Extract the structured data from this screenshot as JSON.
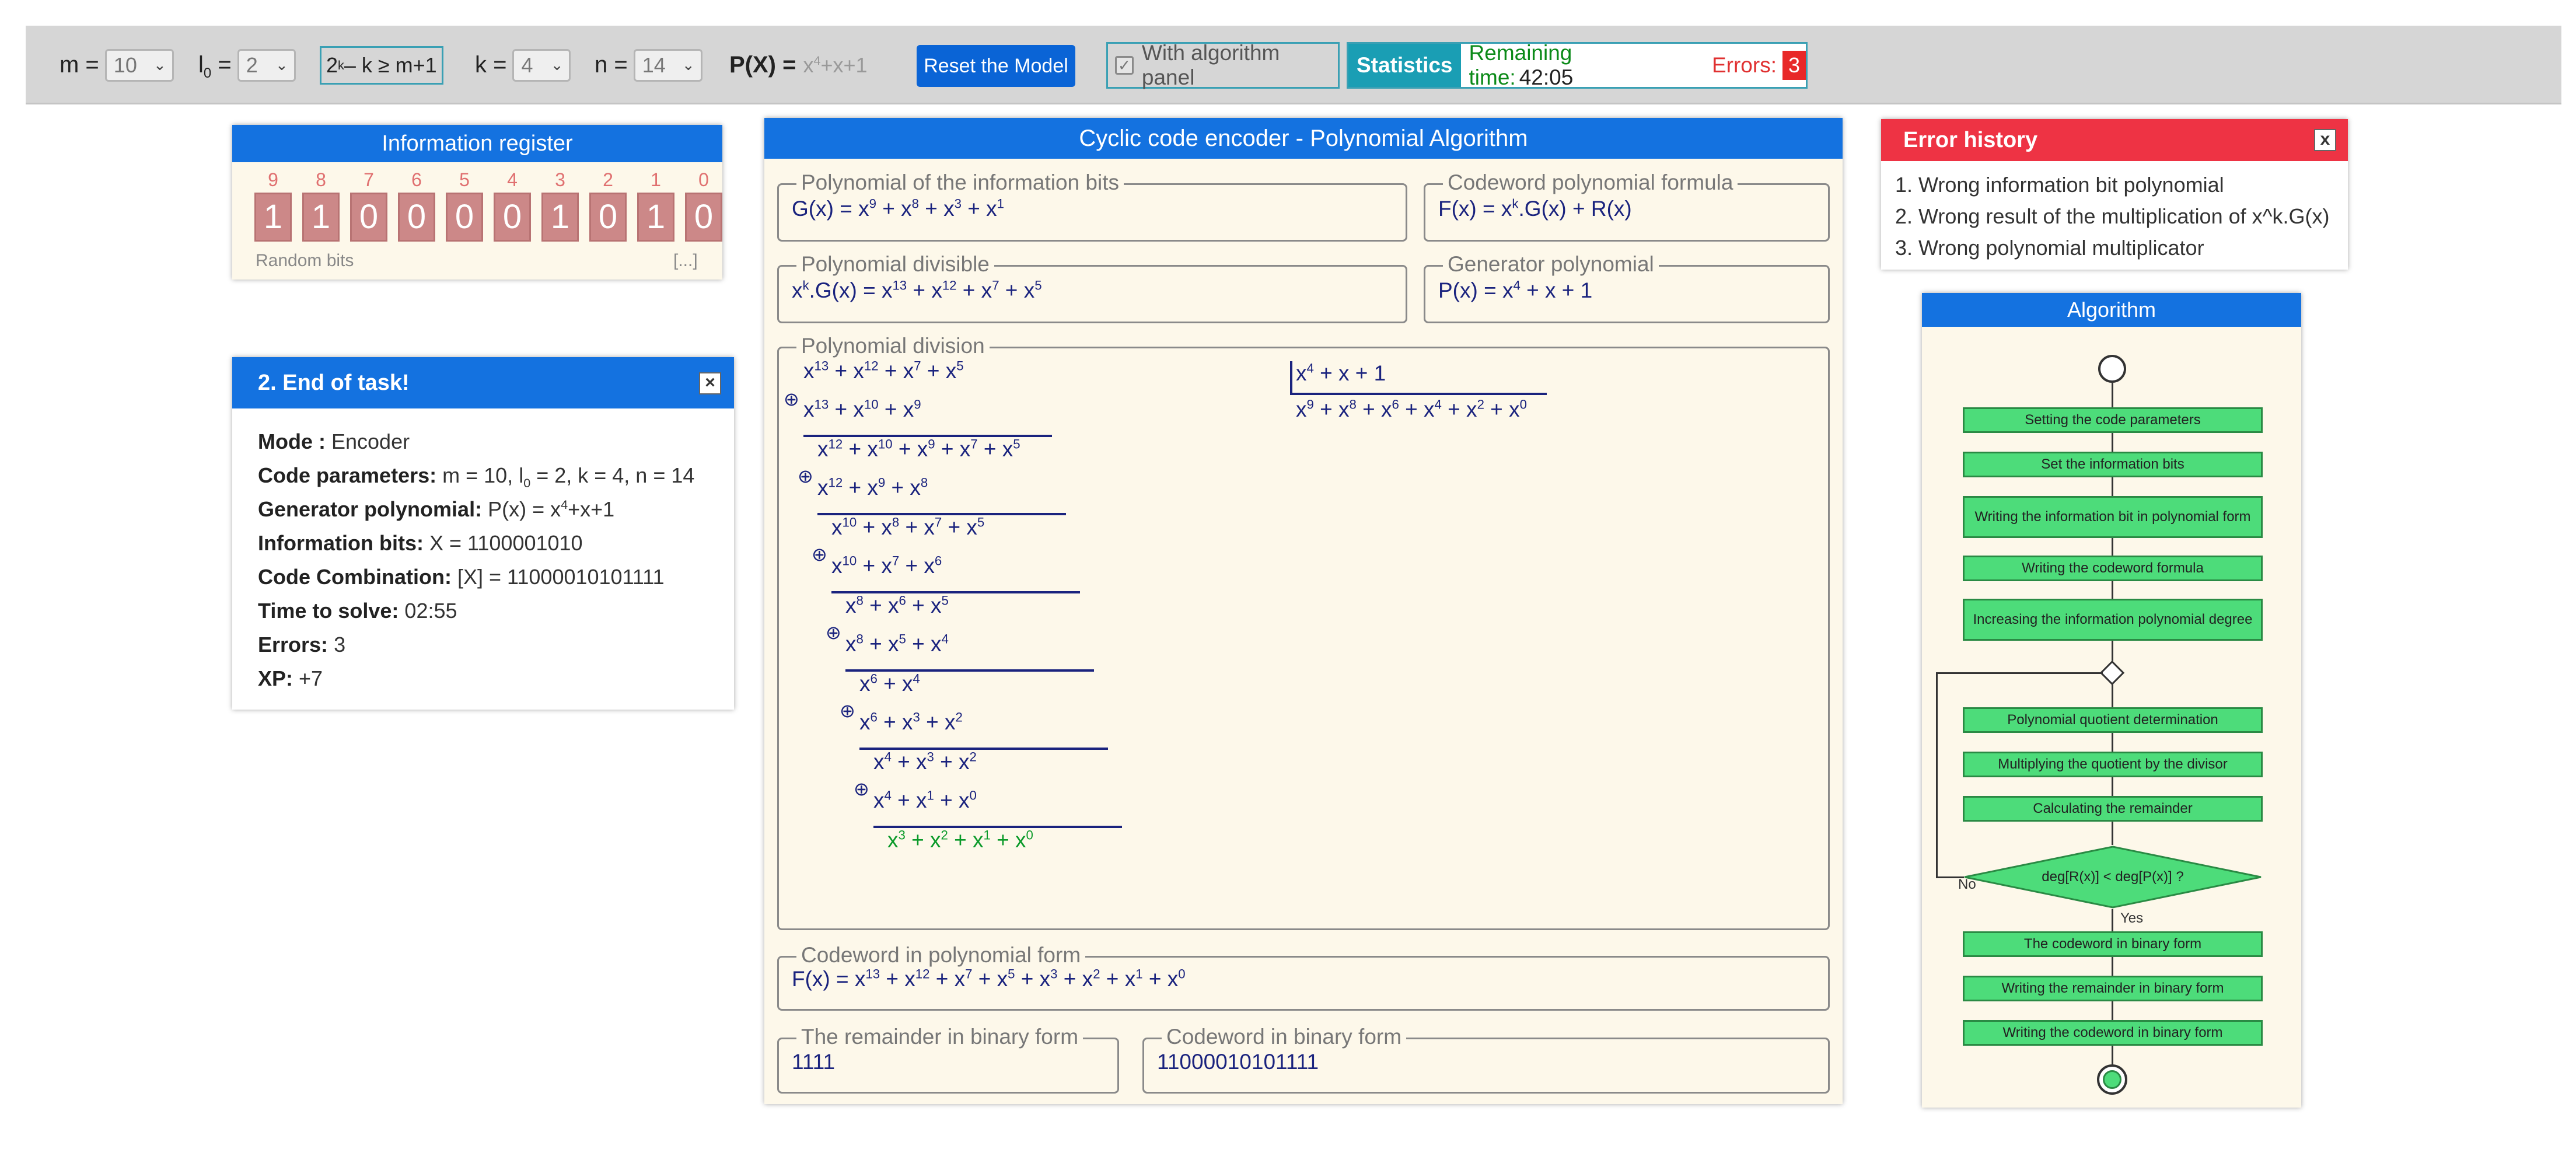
{
  "toolbar": {
    "m_label": "m =",
    "m_value": "10",
    "l0_label": "l",
    "l0_sub": "0",
    "l0_eq": " =",
    "l0_value": "2",
    "cond_base": "2",
    "cond_sup": "k",
    "cond_rest": "– k ≥ m+1",
    "k_label": "k =",
    "k_value": "4",
    "n_label": "n =",
    "n_value": "14",
    "px_label": "P(X) =",
    "px_x": "x",
    "px_sup": "4",
    "px_rest": "+x+1",
    "reset_label": "Reset the Model",
    "algo_panel_label": "With algorithm panel",
    "stats_label": "Statistics",
    "remaining_label": "Remaining time:",
    "remaining_value": "42:05",
    "errors_label": "Errors:",
    "errors_value": "3"
  },
  "info_register": {
    "title": "Information register",
    "indices": [
      "9",
      "8",
      "7",
      "6",
      "5",
      "4",
      "3",
      "2",
      "1",
      "0"
    ],
    "bits": [
      "1",
      "1",
      "0",
      "0",
      "0",
      "0",
      "1",
      "0",
      "1",
      "0"
    ],
    "random_label": "Random bits",
    "more_label": "[...]"
  },
  "end_task": {
    "title": "2. End of task!",
    "close": "×",
    "mode_label": "Mode :",
    "mode_value": "Encoder",
    "params_label": "Code parameters:",
    "params_value_a": "m = 10, l",
    "params_value_sub": "0",
    "params_value_b": " = 2, k = 4, n = 14",
    "gen_label": "Generator polynomial:",
    "gen_value_a": "P(x) = x",
    "gen_value_sup": "4",
    "gen_value_b": "+x+1",
    "bits_label": "Information bits:",
    "bits_value": "X = 1100001010",
    "combo_label": "Code Combination:",
    "combo_value": "[X] = 11000010101111",
    "time_label": "Time to solve:",
    "time_value": "02:55",
    "errors_label": "Errors:",
    "errors_value": "3",
    "xp_label": "XP:",
    "xp_value": "+7"
  },
  "encoder": {
    "title": "Cyclic code encoder - Polynomial Algorithm",
    "info_poly_legend": "Polynomial of the information bits",
    "info_poly": [
      "G(x) = x",
      "9",
      " + x",
      "8",
      " + x",
      "3",
      " + x",
      "1",
      ""
    ],
    "codeword_formula_legend": "Codeword polynomial formula",
    "codeword_formula": [
      "F(x) = x",
      "k",
      ".G(x) + R(x)"
    ],
    "divisible_legend": "Polynomial divisible",
    "divisible": [
      "x",
      "k",
      ".G(x) = x",
      "13",
      " + x",
      "12",
      " + x",
      "7",
      " + x",
      "5",
      ""
    ],
    "generator_legend": "Generator polynomial",
    "generator": [
      "P(x) = x",
      "4",
      " + x + 1"
    ],
    "division_legend": "Polynomial division",
    "division_lines": [
      [
        "x",
        "13",
        " + x",
        "12",
        " + x",
        "7",
        " + x",
        "5",
        ""
      ],
      [
        "x",
        "13",
        " + x",
        "10",
        " + x",
        "9",
        ""
      ],
      [
        "x",
        "12",
        " + x",
        "10",
        " + x",
        "9",
        " + x",
        "7",
        " + x",
        "5",
        ""
      ],
      [
        "x",
        "12",
        " + x",
        "9",
        " + x",
        "8",
        ""
      ],
      [
        "x",
        "10",
        " + x",
        "8",
        " + x",
        "7",
        " + x",
        "5",
        ""
      ],
      [
        "x",
        "10",
        " + x",
        "7",
        " + x",
        "6",
        ""
      ],
      [
        "x",
        "8",
        " + x",
        "6",
        " + x",
        "5",
        ""
      ],
      [
        "x",
        "8",
        " + x",
        "5",
        " + x",
        "4",
        ""
      ],
      [
        "x",
        "6",
        " + x",
        "4",
        ""
      ],
      [
        "x",
        "6",
        " + x",
        "3",
        " + x",
        "2",
        ""
      ],
      [
        "x",
        "4",
        " + x",
        "3",
        " + x",
        "2",
        ""
      ],
      [
        "x",
        "4",
        " + x",
        "1",
        " + x",
        "0",
        ""
      ],
      [
        "x",
        "3",
        " + x",
        "2",
        " + x",
        "1",
        " + x",
        "0",
        ""
      ]
    ],
    "oplus_symbol": "⊕",
    "divisor": [
      "x",
      "4",
      " + x + 1"
    ],
    "quotient": [
      "x",
      "9",
      " + x",
      "8",
      " + x",
      "6",
      " + x",
      "4",
      " + x",
      "2",
      " + x",
      "0",
      ""
    ],
    "codeword_poly_legend": "Codeword in polynomial form",
    "codeword_poly": [
      "F(x) = x",
      "13",
      " + x",
      "12",
      " + x",
      "7",
      " + x",
      "5",
      " + x",
      "3",
      " + x",
      "2",
      " + x",
      "1",
      " + x",
      "0",
      ""
    ],
    "remainder_bin_legend": "The remainder in binary form",
    "remainder_bin": "1111",
    "codeword_bin_legend": "Codeword in binary form",
    "codeword_bin": "11000010101111"
  },
  "error_history": {
    "title": "Error history",
    "close": "x",
    "items": [
      "1. Wrong information bit polynomial",
      "2. Wrong result of the multiplication of x^k.G(x)",
      "3. Wrong polynomial multiplicator"
    ]
  },
  "algorithm": {
    "title": "Algorithm",
    "steps": [
      "Setting the code parameters",
      "Set the information bits",
      "Writing the information bit in polynomial form",
      "Writing the codeword formula",
      "Increasing the information polynomial degree",
      "Polynomial quotient determination",
      "Multiplying the quotient by the divisor",
      "Calculating the remainder",
      "The codeword in binary form",
      "Writing the remainder in binary form",
      "Writing the codeword in binary form"
    ],
    "decision": "deg[R(x)] < deg[P(x)] ?",
    "no_label": "No",
    "yes_label": "Yes"
  },
  "colors": {
    "header_blue": "#1472e0",
    "error_red": "#ee3344",
    "flow_green": "#4ddc7a",
    "remainder_green": "#0b9a2a",
    "poly_navy": "#1a237e"
  }
}
